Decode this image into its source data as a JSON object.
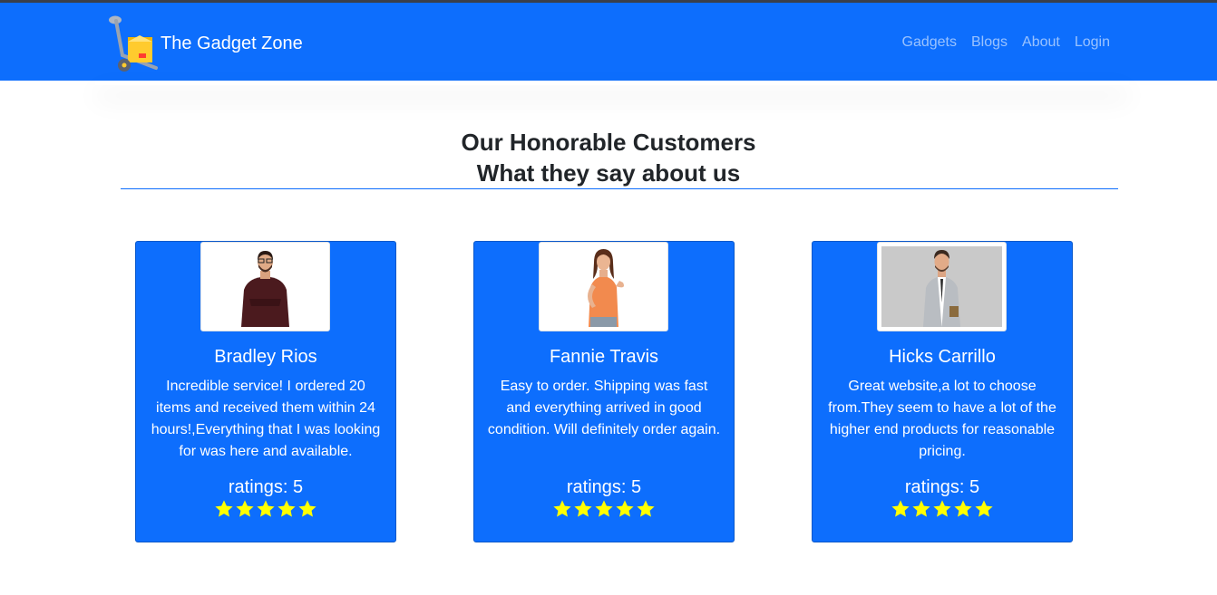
{
  "navbar": {
    "brand": "The Gadget Zone",
    "links": [
      "Gadgets",
      "Blogs",
      "About",
      "Login"
    ]
  },
  "section": {
    "title": "Our Honorable Customers",
    "subtitle": "What they say about us"
  },
  "testimonials": [
    {
      "name": "Bradley Rios",
      "text": "Incredible service! I ordered 20 items and received them within 24 hours!,Everything that I was looking for was here and available.",
      "rating_label": "ratings: 5",
      "stars": 5
    },
    {
      "name": "Fannie Travis",
      "text": "Easy to order. Shipping was fast and everything arrived in good condition. Will definitely order again.",
      "rating_label": "ratings: 5",
      "stars": 5
    },
    {
      "name": "Hicks Carrillo",
      "text": "Great website,a lot to choose from.They seem to have a lot of the higher end products for reasonable pricing.",
      "rating_label": "ratings: 5",
      "stars": 5
    }
  ],
  "icons": {
    "logo": "hand-truck-icon",
    "rating": "star-icon"
  },
  "colors": {
    "primary": "#0d6efd",
    "star": "#ffff00",
    "text_dark": "#212529"
  }
}
